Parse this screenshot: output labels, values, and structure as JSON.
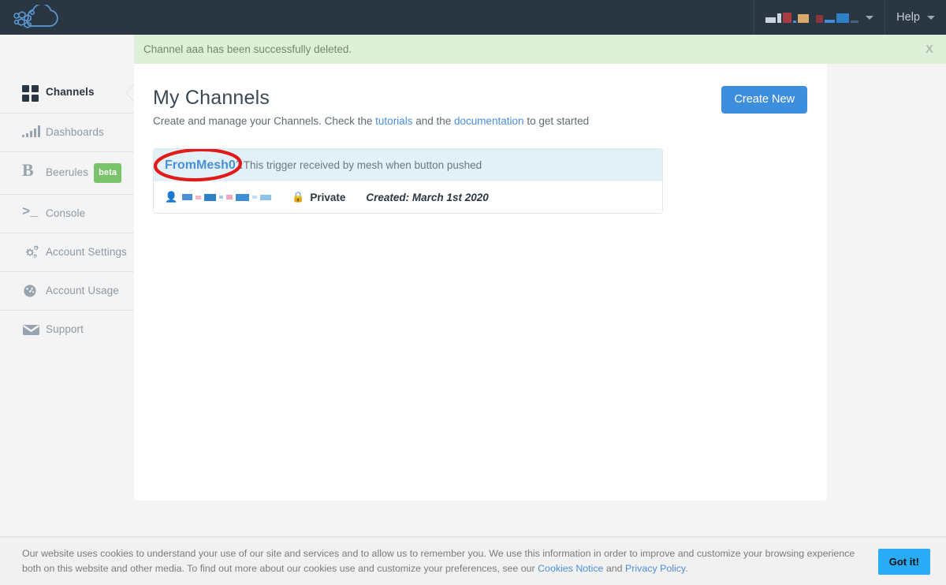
{
  "topbar": {
    "logo_name": "cloud-logo",
    "user_menu": {
      "label_redacted": true,
      "blocks": [
        {
          "w": 13,
          "h": 7,
          "color": "#c9d4de"
        },
        {
          "w": 5,
          "h": 12,
          "color": "#c9d4de"
        },
        {
          "w": 11,
          "h": 13,
          "color": "#a83c43"
        },
        {
          "w": 4,
          "h": 3,
          "color": "#4a90d9"
        },
        {
          "w": 14,
          "h": 11,
          "color": "#d9a96b"
        },
        {
          "w": 5,
          "h": 5,
          "color": "#2b3643"
        },
        {
          "w": 9,
          "h": 10,
          "color": "#8d353c"
        },
        {
          "w": 13,
          "h": 4,
          "color": "#3f8fd4"
        },
        {
          "w": 16,
          "h": 12,
          "color": "#2f7fc9"
        },
        {
          "w": 10,
          "h": 3,
          "color": "#4a6278"
        }
      ]
    },
    "help_label": "Help"
  },
  "notification": {
    "message": "Channel aaa has been successfully deleted.",
    "close_label": "X",
    "background": "#dff0d8"
  },
  "sidebar": {
    "items": [
      {
        "label": "Channels",
        "icon": "grid-icon",
        "active": true,
        "badge": null
      },
      {
        "label": "Dashboards",
        "icon": "bars-icon",
        "active": false,
        "badge": null
      },
      {
        "label": "Beerules",
        "icon": "b-icon",
        "active": false,
        "badge": "beta"
      },
      {
        "label": "Console",
        "icon": "console-icon",
        "active": false,
        "badge": null
      },
      {
        "label": "Account Settings",
        "icon": "gears-icon",
        "active": false,
        "badge": null
      },
      {
        "label": "Account Usage",
        "icon": "gauge-icon",
        "active": false,
        "badge": null
      },
      {
        "label": "Support",
        "icon": "envelope-icon",
        "active": false,
        "badge": null
      }
    ]
  },
  "main": {
    "title": "My Channels",
    "subtitle_part1": "Create and manage your Channels. Check the ",
    "link_tutorials": "tutorials",
    "subtitle_part2": " and the ",
    "link_documentation": "documentation",
    "subtitle_part3": " to get started",
    "create_button": "Create New",
    "channel": {
      "name": "FromMesh01",
      "description": "This trigger received by mesh when button pushed",
      "owner_redacted": true,
      "owner_blocks": [
        {
          "w": 13,
          "h": 8,
          "color": "#4a90d9"
        },
        {
          "w": 7,
          "h": 5,
          "color": "#f2b8c6"
        },
        {
          "w": 15,
          "h": 9,
          "color": "#2f7fc9"
        },
        {
          "w": 5,
          "h": 4,
          "color": "#9fd0f0"
        },
        {
          "w": 8,
          "h": 6,
          "color": "#f0a8bd"
        },
        {
          "w": 17,
          "h": 9,
          "color": "#3f8fd4"
        },
        {
          "w": 6,
          "h": 4,
          "color": "#bfe0f5"
        },
        {
          "w": 14,
          "h": 7,
          "color": "#8fc4ea"
        }
      ],
      "visibility": "Private",
      "created": "Created: March 1st 2020",
      "annotation_color": "#e01b18"
    }
  },
  "cookie": {
    "text_part1": "Our website uses cookies to understand your use of our site and services and to allow us to remember you. We use this information in order to improve and customize your browsing experience both on this website and other media. To find out more about our cookies use and customize your preferences, see our ",
    "link_cookies": "Cookies Notice",
    "text_part2": " and ",
    "link_privacy": "Privacy Policy",
    "text_part3": ".",
    "button": "Got it!"
  }
}
